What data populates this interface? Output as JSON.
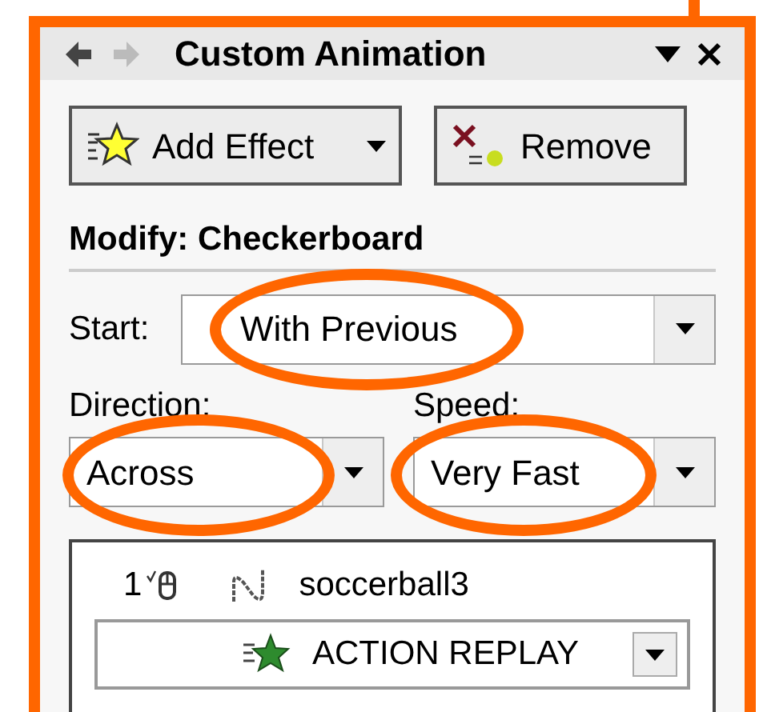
{
  "panel": {
    "title": "Custom Animation",
    "buttons": [
      {
        "label": "Add Effect",
        "kind": "add"
      },
      {
        "label": "Remove",
        "kind": "remove"
      }
    ],
    "section_title": "Modify: Checkerboard",
    "start": {
      "label": "Start:",
      "value": "With Previous",
      "circled": true
    },
    "direction": {
      "label": "Direction:",
      "value": "Across",
      "circled": true
    },
    "speed": {
      "label": "Speed:",
      "value": "Very Fast",
      "circled": true
    },
    "animation_list": [
      {
        "order": "1",
        "name": "soccerball3",
        "effect": "ACTION REPLAY"
      }
    ]
  }
}
